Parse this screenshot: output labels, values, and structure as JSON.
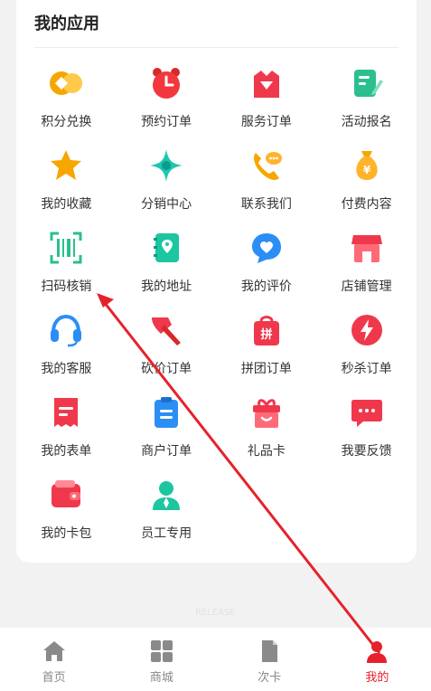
{
  "section": {
    "title": "我的应用"
  },
  "apps": [
    {
      "id": "points",
      "label": "积分兑换"
    },
    {
      "id": "booking",
      "label": "预约订单"
    },
    {
      "id": "service",
      "label": "服务订单"
    },
    {
      "id": "activity",
      "label": "活动报名"
    },
    {
      "id": "favorites",
      "label": "我的收藏"
    },
    {
      "id": "distribution",
      "label": "分销中心"
    },
    {
      "id": "contact",
      "label": "联系我们"
    },
    {
      "id": "paid",
      "label": "付费内容"
    },
    {
      "id": "scan",
      "label": "扫码核销"
    },
    {
      "id": "address",
      "label": "我的地址"
    },
    {
      "id": "reviews",
      "label": "我的评价"
    },
    {
      "id": "store",
      "label": "店铺管理"
    },
    {
      "id": "support",
      "label": "我的客服"
    },
    {
      "id": "bargain",
      "label": "砍价订单"
    },
    {
      "id": "group",
      "label": "拼团订单"
    },
    {
      "id": "flash",
      "label": "秒杀订单"
    },
    {
      "id": "forms",
      "label": "我的表单"
    },
    {
      "id": "merchant",
      "label": "商户订单"
    },
    {
      "id": "giftcard",
      "label": "礼品卡"
    },
    {
      "id": "feedback",
      "label": "我要反馈"
    },
    {
      "id": "wallet",
      "label": "我的卡包"
    },
    {
      "id": "staff",
      "label": "员工专用"
    }
  ],
  "tabbar": {
    "items": [
      {
        "label": "首页",
        "icon": "home-icon"
      },
      {
        "label": "商城",
        "icon": "grid-icon"
      },
      {
        "label": "次卡",
        "icon": "card-icon"
      },
      {
        "label": "我的",
        "icon": "user-icon"
      }
    ],
    "active_color": "#e5222b",
    "inactive_color": "#888888"
  },
  "watermark": "RELEASE",
  "colors": {
    "accent": "#e5222b"
  }
}
